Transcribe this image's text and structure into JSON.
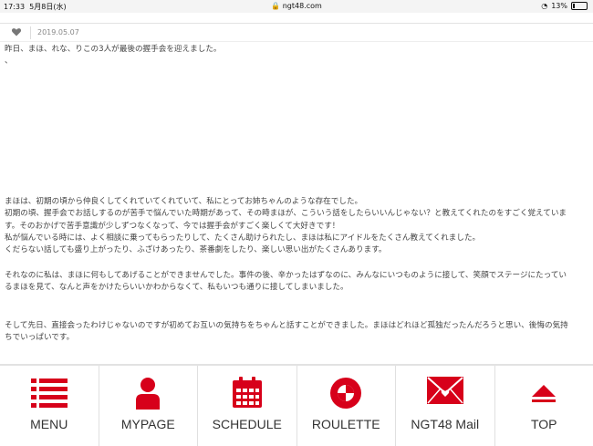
{
  "status_bar": {
    "time": "17:33",
    "date": "5月8日(水)",
    "url": "ngt48.com",
    "battery": "13%"
  },
  "post": {
    "date": "2019.05.07",
    "lines_1": [
      "昨日、まほ、れな、りこの3人が最後の握手会を迎えました。",
      "、"
    ],
    "lines_2": [
      "まほは、初期の頃から仲良くしてくれていてくれていて、私にとってお姉ちゃんのような存在でした。",
      "初期の頃、握手会でお話しするのが苦手で悩んでいた時期があって、その時まほが、こういう話をしたらいいんじゃない？と教えてくれたのをすごく覚えていま",
      "す。そのおかげで苦手意識が少しずつなくなって、今では握手会がすごく楽しくて大好きです！",
      "私が悩んでいる時には、よく相談に乗ってもらったりして、たくさん助けられたし、まほは私にアイドルをたくさん教えてくれました。",
      "くだらない話しても盛り上がったり、ふざけあったり、茶番劇をしたり、楽しい思い出がたくさんあります。"
    ],
    "lines_3": [
      "それなのに私は、まほに何もしてあげることができませんでした。事件の後、辛かったはずなのに、みんなにいつものように接して、笑顔でステージにたってい",
      "るまほを見て、なんと声をかけたらいいかわからなくて、私もいつも通りに接してしまいました。"
    ],
    "lines_4": [
      "そして先日、直接会ったわけじゃないのですが初めてお互いの気持ちをちゃんと話すことができました。まほはどれほど孤独だったんだろうと思い、後悔の気持",
      "ちでいっぱいです。"
    ]
  },
  "nav": {
    "menu": "MENU",
    "mypage": "MYPAGE",
    "schedule": "SCHEDULE",
    "roulette": "ROULETTE",
    "mail": "NGT48 Mail",
    "top": "TOP"
  },
  "colors": {
    "accent": "#d7001a",
    "nav_text": "#333333"
  }
}
